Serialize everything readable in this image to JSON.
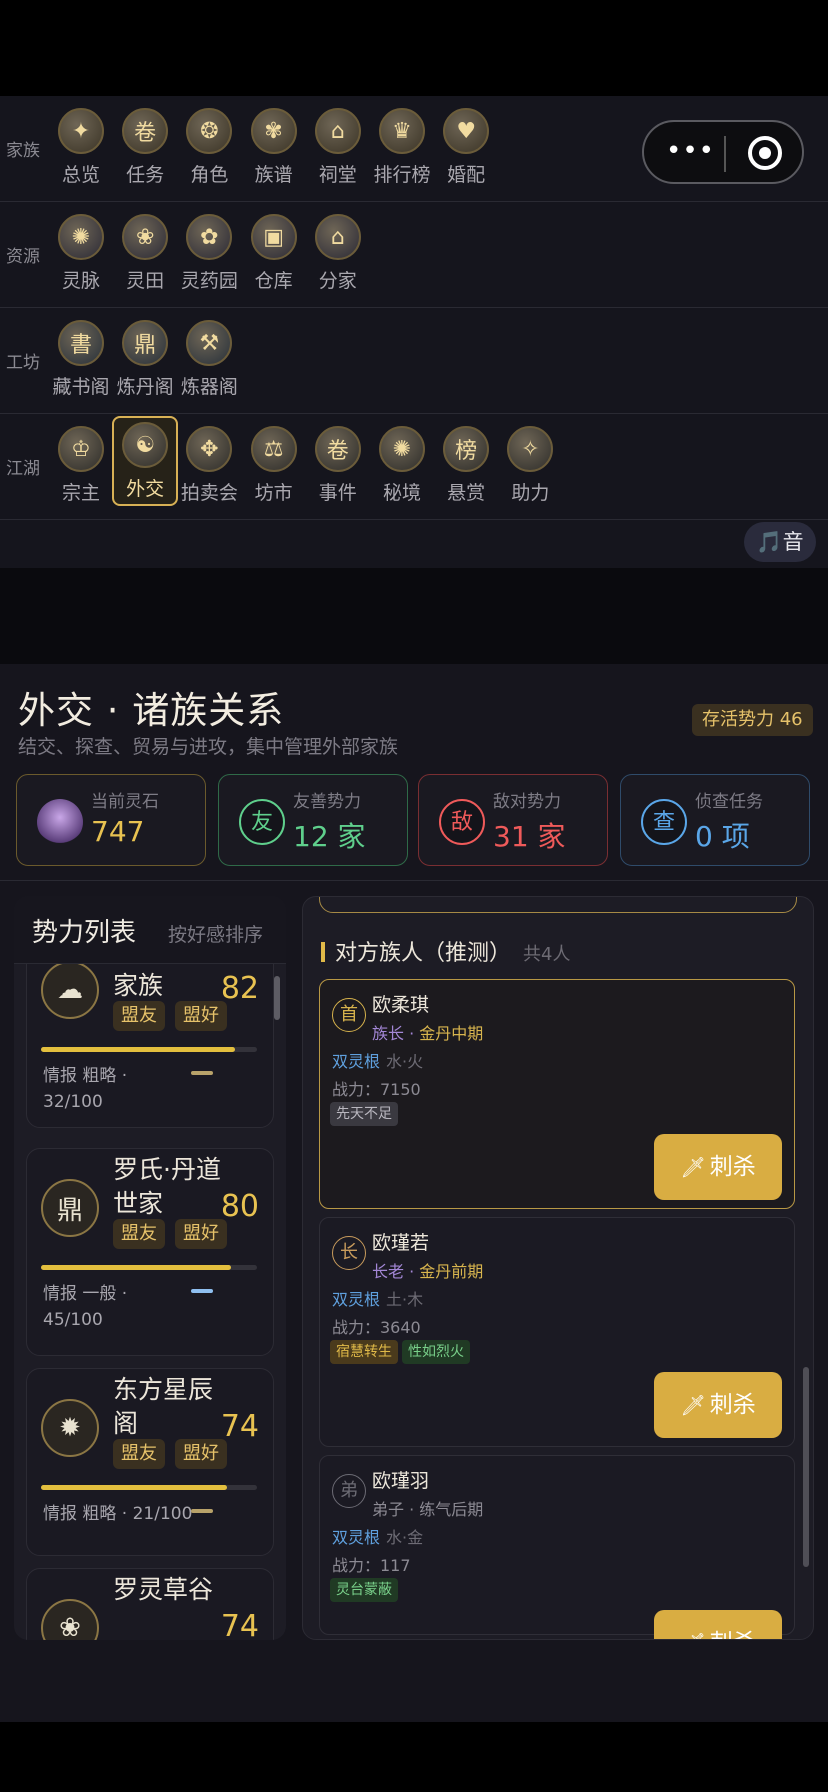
{
  "menu": {
    "rows": [
      {
        "category": "家族",
        "items": [
          {
            "label": "总览",
            "glyph": "✦"
          },
          {
            "label": "任务",
            "glyph": "卷"
          },
          {
            "label": "角色",
            "glyph": "❂"
          },
          {
            "label": "族谱",
            "glyph": "✾"
          },
          {
            "label": "祠堂",
            "glyph": "⌂"
          },
          {
            "label": "排行榜",
            "glyph": "♛"
          },
          {
            "label": "婚配",
            "glyph": "♥"
          }
        ]
      },
      {
        "category": "资源",
        "items": [
          {
            "label": "灵脉",
            "glyph": "✺"
          },
          {
            "label": "灵田",
            "glyph": "❀"
          },
          {
            "label": "灵药园",
            "glyph": "✿"
          },
          {
            "label": "仓库",
            "glyph": "▣"
          },
          {
            "label": "分家",
            "glyph": "⌂"
          }
        ]
      },
      {
        "category": "工坊",
        "items": [
          {
            "label": "藏书阁",
            "glyph": "書"
          },
          {
            "label": "炼丹阁",
            "glyph": "鼎"
          },
          {
            "label": "炼器阁",
            "glyph": "⚒"
          }
        ]
      },
      {
        "category": "江湖",
        "items": [
          {
            "label": "宗主",
            "glyph": "♔"
          },
          {
            "label": "外交",
            "glyph": "☯"
          },
          {
            "label": "拍卖会",
            "glyph": "✥"
          },
          {
            "label": "坊市",
            "glyph": "⚖"
          },
          {
            "label": "事件",
            "glyph": "卷"
          },
          {
            "label": "秘境",
            "glyph": "✺"
          },
          {
            "label": "悬赏",
            "glyph": "榜"
          },
          {
            "label": "助力",
            "glyph": "✧"
          }
        ]
      }
    ],
    "music_label": "🎵音"
  },
  "page": {
    "title": "外交 · 诸族关系",
    "subtitle": "结交、探查、贸易与进攻，集中管理外部家族",
    "survive_badge": "存活势力 46"
  },
  "stats": [
    {
      "label": "当前灵石",
      "value": "747",
      "icon": "",
      "color": "#e8c251",
      "border": "#6b5a2c"
    },
    {
      "label": "友善势力",
      "value": "12 家",
      "icon": "友",
      "color": "#5fcf8c",
      "border": "#2f6a48"
    },
    {
      "label": "敌对势力",
      "value": "31 家",
      "icon": "敌",
      "color": "#ef5a5a",
      "border": "#7a2e32"
    },
    {
      "label": "侦查任务",
      "value": "0 项",
      "icon": "查",
      "color": "#5aa6e8",
      "border": "#2f4b6a"
    }
  ],
  "factions": {
    "title": "势力列表",
    "sort_label": "按好感排序",
    "items": [
      {
        "name": "刘氏·隐世家族",
        "score": "82",
        "tags": [
          "盟友",
          "盟好"
        ],
        "intel": "情报 粗略 · 32/100",
        "favor": 0.9,
        "glyph": "☁",
        "mini": "#b8a26a"
      },
      {
        "name": "罗氏·丹道世家",
        "score": "80",
        "tags": [
          "盟友",
          "盟好"
        ],
        "intel": "情报 一般 · 45/100",
        "favor": 0.88,
        "glyph": "鼎",
        "mini": "#8fbff0"
      },
      {
        "name": "东方星辰阁",
        "score": "74",
        "tags": [
          "盟友",
          "盟好"
        ],
        "intel": "情报 粗略 · 21/100",
        "favor": 0.86,
        "glyph": "✹",
        "mini": "#b8a26a"
      },
      {
        "name": "罗灵草谷",
        "score": "74",
        "tags": [],
        "intel": "",
        "favor": 0,
        "glyph": "❀",
        "mini": ""
      }
    ]
  },
  "clan": {
    "title": "对方族人（推测）",
    "count": "共4人",
    "members": [
      {
        "badge": "首",
        "name": "欧柔琪",
        "rank": "族长",
        "realm": "金丹中期",
        "root": "双灵根",
        "elements": "水·火",
        "power": "战力：7150",
        "traits": [
          {
            "t": "先天不足",
            "bg": "#3a3940",
            "fg": "#b9b7bf"
          }
        ],
        "button": "刺杀"
      },
      {
        "badge": "长",
        "name": "欧瑾若",
        "rank": "长老",
        "realm": "金丹前期",
        "root": "双灵根",
        "elements": "土·木",
        "power": "战力：3640",
        "traits": [
          {
            "t": "宿慧转生",
            "bg": "#4a3a1c",
            "fg": "#e0b948"
          },
          {
            "t": "性如烈火",
            "bg": "#203a24",
            "fg": "#79d08a"
          }
        ],
        "button": "刺杀"
      },
      {
        "badge": "弟",
        "name": "欧瑾羽",
        "rank": "弟子",
        "realm": "练气后期",
        "root": "双灵根",
        "elements": "水·金",
        "power": "战力：117",
        "traits": [
          {
            "t": "灵台蒙蔽",
            "bg": "#203a24",
            "fg": "#79d08a"
          }
        ],
        "button": "刺杀"
      }
    ]
  },
  "assassinate_icon": "🗡"
}
